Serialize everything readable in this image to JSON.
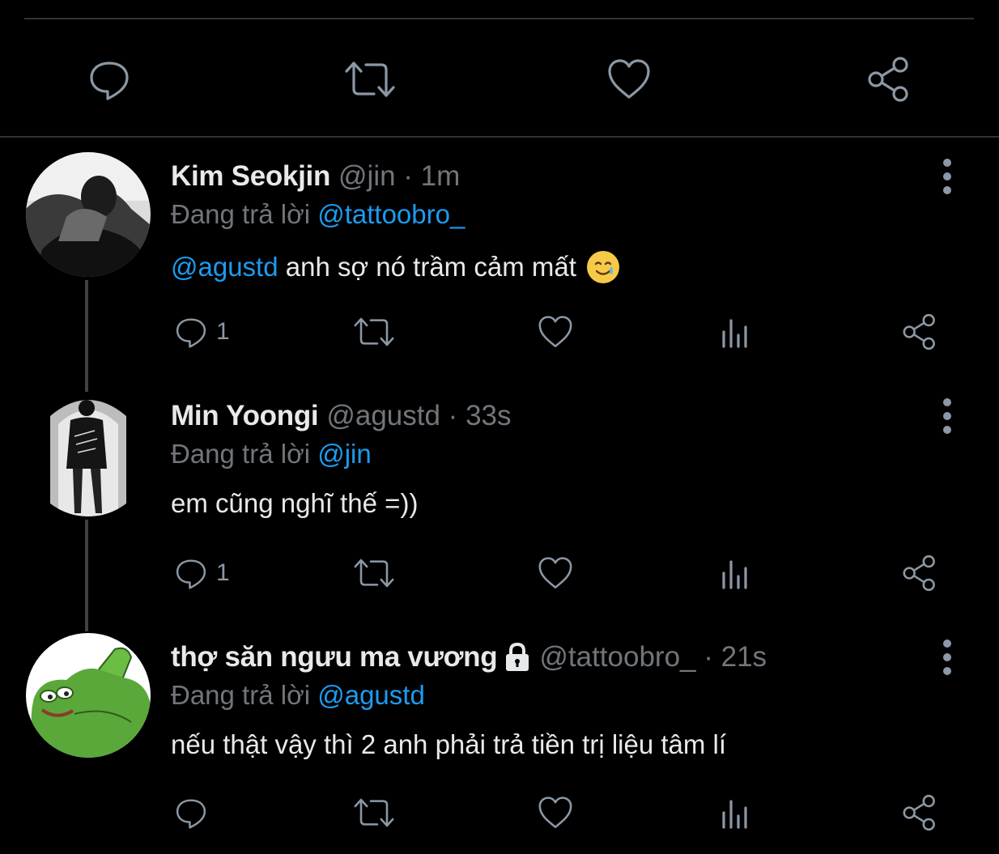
{
  "main_actions": {
    "icons": [
      "reply-icon",
      "retweet-icon",
      "like-icon",
      "share-icon"
    ]
  },
  "tweets": [
    {
      "name": "Kim Seokjin",
      "handle": "@jin · 1m",
      "replying_prefix": "Đang trả lời",
      "replying_to": "@tattoobro_",
      "body_mention": "@agustd",
      "body_text": " anh sợ nó trầm cảm mất",
      "emoji": "smiling-face-with-tear-icon",
      "reply_count": "1",
      "retweet_count": "",
      "like_count": ""
    },
    {
      "name": "Min Yoongi",
      "handle": "@agustd · 33s",
      "replying_prefix": "Đang trả lời",
      "replying_to": "@jin",
      "body_text": "em cũng nghĩ thế =))",
      "reply_count": "1",
      "retweet_count": "",
      "like_count": ""
    },
    {
      "name": "thợ săn ngưu ma vương",
      "handle": "@tattoobro_ · 21s",
      "replying_prefix": "Đang trả lời",
      "replying_to": "@agustd",
      "body_text": "nếu thật vậy thì 2 anh phải trả tiền trị liệu tâm lí",
      "reply_count": "",
      "retweet_count": "",
      "like_count": ""
    }
  ],
  "colors": {
    "background": "#000000",
    "text": "#e7e9ea",
    "secondary": "#71767b",
    "icon": "#8b98a5",
    "link": "#1d9bf0",
    "divider": "#2f3336"
  }
}
